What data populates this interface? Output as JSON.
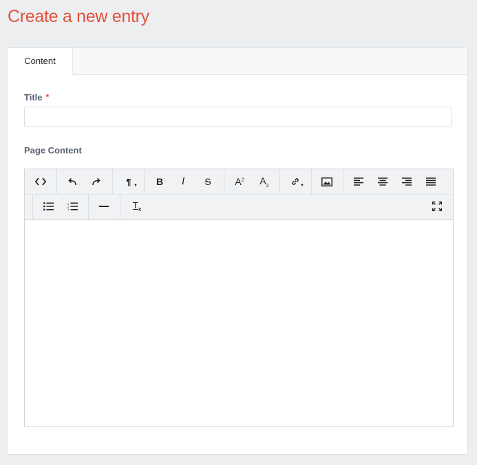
{
  "page": {
    "title": "Create a new entry"
  },
  "tabs": [
    {
      "label": "Content",
      "active": true
    }
  ],
  "form": {
    "title_label": "Title",
    "required_marker": "*",
    "title_value": "",
    "page_content_label": "Page Content"
  },
  "toolbar": {
    "row1": [
      {
        "name": "source-code",
        "icon": "code-icon"
      },
      {
        "name": "undo",
        "icon": "undo-icon"
      },
      {
        "name": "redo",
        "icon": "redo-icon"
      },
      {
        "name": "paragraph-format",
        "icon": "pilcrow-icon",
        "glyph": "¶"
      },
      {
        "name": "bold",
        "icon": "bold-icon",
        "glyph": "B"
      },
      {
        "name": "italic",
        "icon": "italic-icon",
        "glyph": "I"
      },
      {
        "name": "strikethrough",
        "icon": "strikethrough-icon",
        "glyph": "S"
      },
      {
        "name": "superscript",
        "icon": "superscript-icon",
        "glyph": "A"
      },
      {
        "name": "subscript",
        "icon": "subscript-icon",
        "glyph": "A"
      },
      {
        "name": "link",
        "icon": "link-icon"
      },
      {
        "name": "image",
        "icon": "image-icon"
      },
      {
        "name": "align-left",
        "icon": "align-left-icon"
      },
      {
        "name": "align-center",
        "icon": "align-center-icon"
      },
      {
        "name": "align-right",
        "icon": "align-right-icon"
      },
      {
        "name": "align-justify",
        "icon": "align-justify-icon"
      }
    ],
    "row2": [
      {
        "name": "bullet-list",
        "icon": "bullet-list-icon"
      },
      {
        "name": "numbered-list",
        "icon": "numbered-list-icon"
      },
      {
        "name": "horizontal-rule",
        "icon": "horizontal-rule-icon"
      },
      {
        "name": "clear-formatting",
        "icon": "clear-format-icon",
        "glyph": "T"
      },
      {
        "name": "fullscreen",
        "icon": "fullscreen-icon"
      }
    ]
  },
  "colors": {
    "accent": "#e0523d",
    "label": "#596270",
    "background": "#eceef0",
    "toolbar": "#f0f2f4"
  }
}
